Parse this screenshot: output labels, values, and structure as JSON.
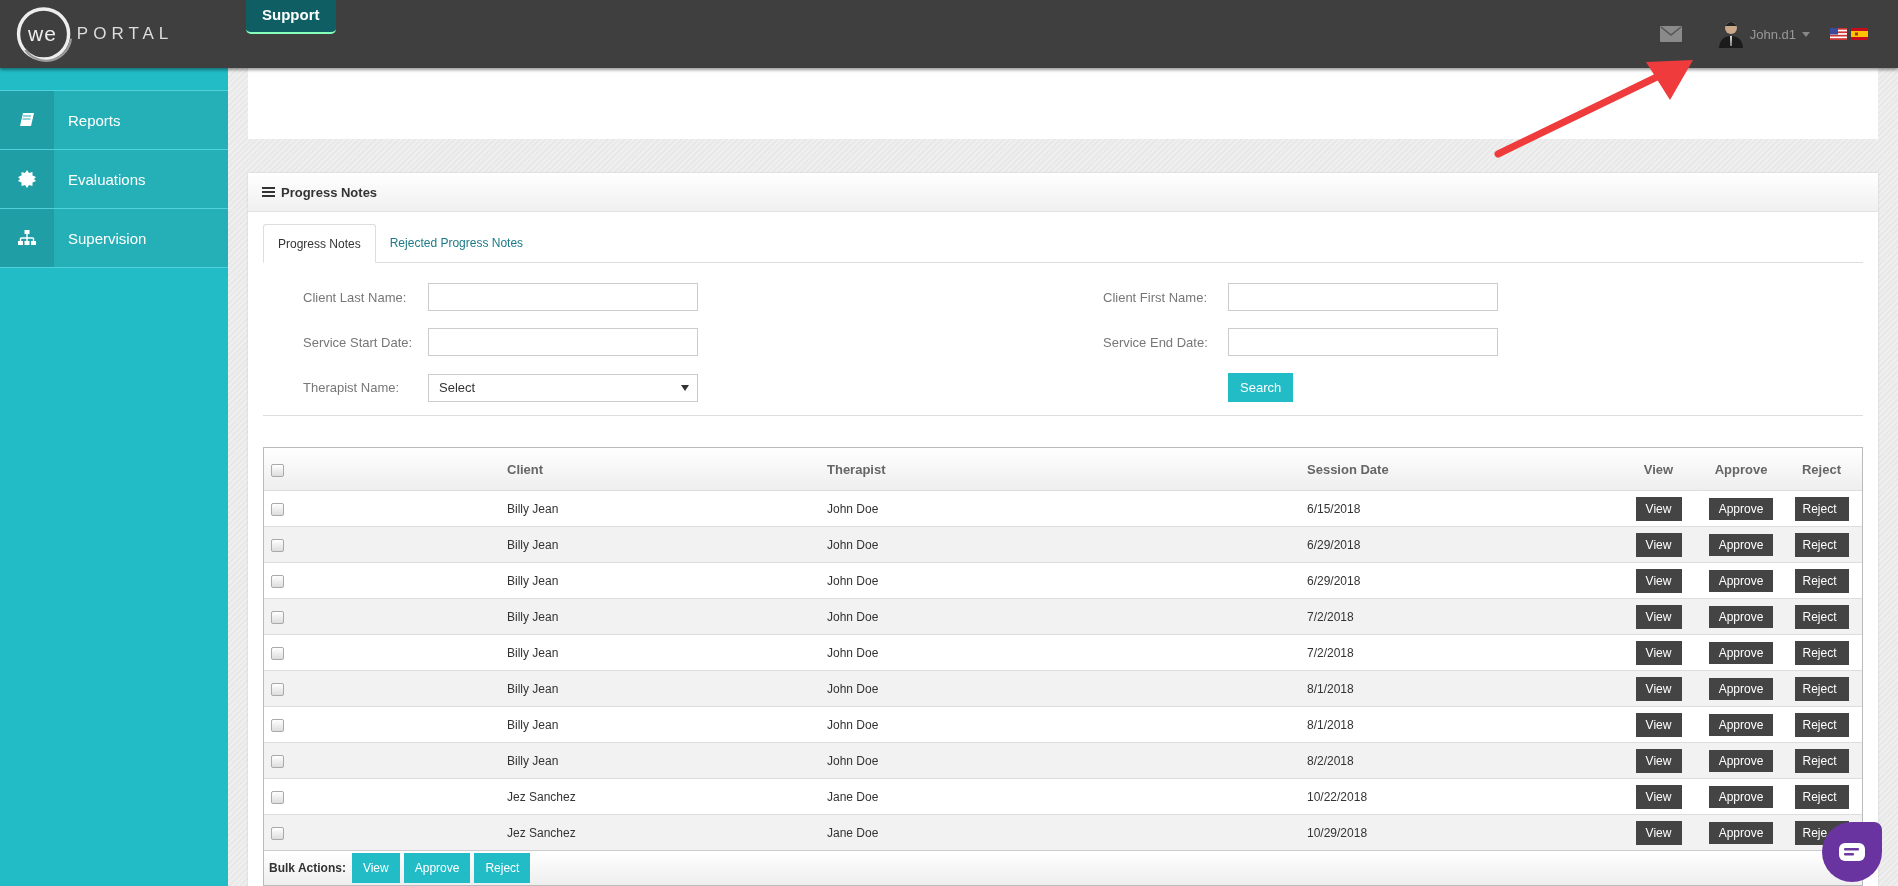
{
  "header": {
    "logo": {
      "left": "we",
      "right": "PORTAL"
    },
    "support_tab": "Support",
    "user": {
      "name": "John.d1"
    }
  },
  "sidebar": {
    "items": [
      {
        "label": "Reports"
      },
      {
        "label": "Evaluations"
      },
      {
        "label": "Supervision"
      }
    ]
  },
  "panel": {
    "title": "Progress Notes",
    "tabs": [
      {
        "label": "Progress Notes",
        "selected": true
      },
      {
        "label": "Rejected Progress Notes",
        "selected": false
      }
    ],
    "filters": [
      {
        "kind": "text",
        "label": "Client Last Name:"
      },
      {
        "kind": "text",
        "label": "Client First Name:"
      },
      {
        "kind": "text",
        "label": "Service Start Date:"
      },
      {
        "kind": "text",
        "label": "Service End Date:"
      },
      {
        "kind": "select",
        "label": "Therapist Name:",
        "value": "Select"
      },
      {
        "kind": "button",
        "label": "Search"
      }
    ],
    "table": {
      "header_checked": false,
      "columns": [
        "Client",
        "Therapist",
        "Session Date",
        "View",
        "Approve",
        "Reject"
      ],
      "rows": [
        {
          "checked": false,
          "client": "Billy Jean",
          "therapist": "John Doe",
          "session_date": "6/15/2018",
          "view": "View",
          "approve": "Approve",
          "reject": "Reject"
        },
        {
          "checked": false,
          "client": "Billy Jean",
          "therapist": "John Doe",
          "session_date": "6/29/2018",
          "view": "View",
          "approve": "Approve",
          "reject": "Reject"
        },
        {
          "checked": false,
          "client": "Billy Jean",
          "therapist": "John Doe",
          "session_date": "6/29/2018",
          "view": "View",
          "approve": "Approve",
          "reject": "Reject"
        },
        {
          "checked": false,
          "client": "Billy Jean",
          "therapist": "John Doe",
          "session_date": "7/2/2018",
          "view": "View",
          "approve": "Approve",
          "reject": "Reject"
        },
        {
          "checked": false,
          "client": "Billy Jean",
          "therapist": "John Doe",
          "session_date": "7/2/2018",
          "view": "View",
          "approve": "Approve",
          "reject": "Reject"
        },
        {
          "checked": false,
          "client": "Billy Jean",
          "therapist": "John Doe",
          "session_date": "8/1/2018",
          "view": "View",
          "approve": "Approve",
          "reject": "Reject"
        },
        {
          "checked": false,
          "client": "Billy Jean",
          "therapist": "John Doe",
          "session_date": "8/1/2018",
          "view": "View",
          "approve": "Approve",
          "reject": "Reject"
        },
        {
          "checked": false,
          "client": "Billy Jean",
          "therapist": "John Doe",
          "session_date": "8/2/2018",
          "view": "View",
          "approve": "Approve",
          "reject": "Reject"
        },
        {
          "checked": false,
          "client": "Jez Sanchez",
          "therapist": "Jane Doe",
          "session_date": "10/22/2018",
          "view": "View",
          "approve": "Approve",
          "reject": "Reject"
        },
        {
          "checked": false,
          "client": "Jez Sanchez",
          "therapist": "Jane Doe",
          "session_date": "10/29/2018",
          "view": "View",
          "approve": "Approve",
          "reject": "Reje"
        }
      ]
    },
    "bulk": {
      "label": "Bulk Actions:",
      "buttons": [
        "View",
        "Approve",
        "Reject"
      ]
    }
  }
}
